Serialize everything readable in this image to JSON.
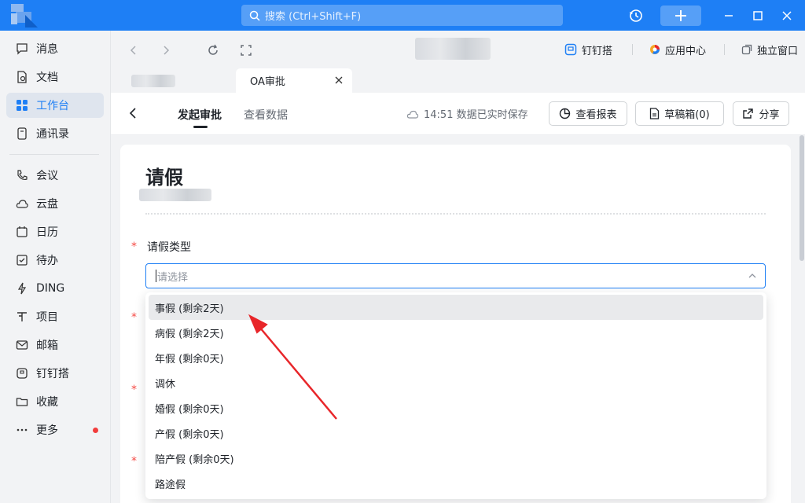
{
  "titlebar": {
    "search_placeholder": "搜索 (Ctrl+Shift+F)",
    "accent": "#1e7ff5"
  },
  "sidebar": {
    "items": [
      {
        "label": "消息",
        "icon": "chat-bubble-icon"
      },
      {
        "label": "文档",
        "icon": "document-icon"
      },
      {
        "label": "工作台",
        "icon": "grid-icon",
        "active": true
      },
      {
        "label": "通讯录",
        "icon": "contacts-icon"
      },
      {
        "label": "会议",
        "icon": "phone-icon"
      },
      {
        "label": "云盘",
        "icon": "cloud-icon"
      },
      {
        "label": "日历",
        "icon": "calendar-icon"
      },
      {
        "label": "待办",
        "icon": "checklist-icon"
      },
      {
        "label": "DING",
        "icon": "lightning-icon"
      },
      {
        "label": "项目",
        "icon": "project-icon"
      },
      {
        "label": "邮箱",
        "icon": "mail-icon"
      },
      {
        "label": "钉钉搭",
        "icon": "builder-icon"
      },
      {
        "label": "收藏",
        "icon": "folder-icon"
      },
      {
        "label": "更多",
        "icon": "more-icon",
        "badge": "dot"
      }
    ]
  },
  "nav": {
    "links": [
      {
        "label": "钉钉搭",
        "icon": "builder-icon"
      },
      {
        "label": "应用中心",
        "icon": "app-center-icon"
      },
      {
        "label": "独立窗口",
        "icon": "window-icon"
      }
    ]
  },
  "tabs": {
    "active_label": "OA审批"
  },
  "header": {
    "tabs": [
      "发起审批",
      "查看数据"
    ],
    "saved_text": "14:51 数据已实时保存",
    "buttons": {
      "report": "查看报表",
      "drafts": "草稿箱(0)",
      "share": "分享"
    }
  },
  "form": {
    "title": "请假",
    "field_label": "请假类型",
    "select_placeholder": "请选择",
    "required_mark": "*"
  },
  "dropdown": {
    "options": [
      "事假 (剩余2天)",
      "病假 (剩余2天)",
      "年假 (剩余0天)",
      "调休",
      "婚假 (剩余0天)",
      "产假 (剩余0天)",
      "陪产假 (剩余0天)",
      "路途假"
    ],
    "hovered_index": 0
  },
  "annotation": {
    "arrow_color": "#e8262a"
  }
}
